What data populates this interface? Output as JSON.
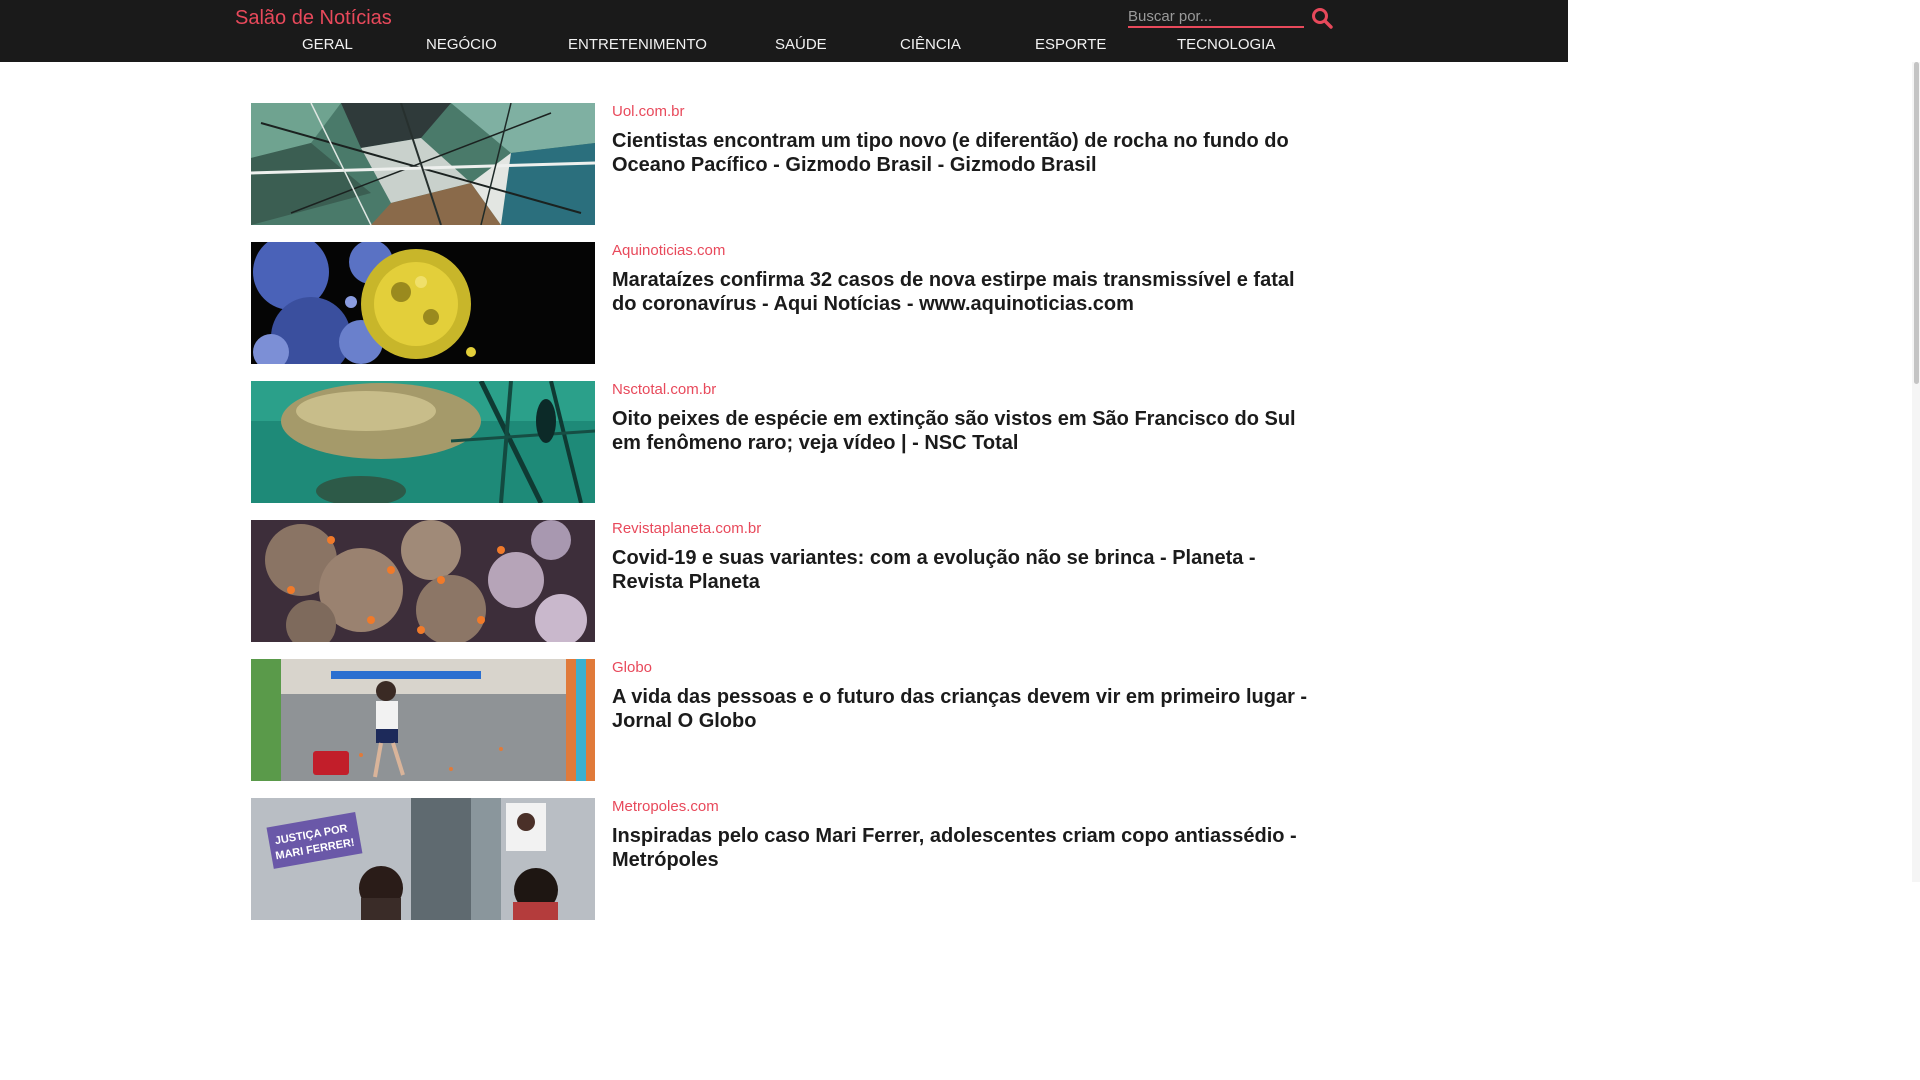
{
  "header": {
    "brand": "Salão de Notícias",
    "search": {
      "placeholder": "Buscar por...",
      "value": ""
    },
    "search_icon": "search-icon",
    "nav": [
      "GERAL",
      "NEGÓCIO",
      "ENTRETENIMENTO",
      "SAÚDE",
      "CIÊNCIA",
      "ESPORTE",
      "TECNOLOGIA"
    ]
  },
  "colors": {
    "accent": "#e8495b",
    "topbar": "#1a1a1a",
    "headline": "#1b1b1b"
  },
  "articles": [
    {
      "source": "Uol.com.br",
      "title": "Cientistas encontram um tipo novo (e diferentão) de rocha no fundo do Oceano Pacífico - Gizmodo Brasil - Gizmodo Brasil"
    },
    {
      "source": "Aquinoticias.com",
      "title": "Marataízes confirma 32 casos de nova estirpe mais transmissível e fatal do coronavírus - Aqui Notícias - www.aquinoticias.com"
    },
    {
      "source": "Nsctotal.com.br",
      "title": "Oito peixes de espécie em extinção são vistos em São Francisco do Sul em fenômeno raro; veja vídeo | - NSC Total"
    },
    {
      "source": "Revistaplaneta.com.br",
      "title": "Covid-19 e suas variantes: com a evolução não se brinca - Planeta - Revista Planeta"
    },
    {
      "source": "Globo",
      "title": "A vida das pessoas e o futuro das crianças devem vir em primeiro lugar - Jornal O Globo"
    },
    {
      "source": "Metropoles.com",
      "title": "Inspiradas pelo caso Mari Ferrer, adolescentes criam copo antiassédio - Metrópoles",
      "image_text": [
        "JUSTIÇA POR",
        "MARI FERRER!"
      ]
    }
  ]
}
